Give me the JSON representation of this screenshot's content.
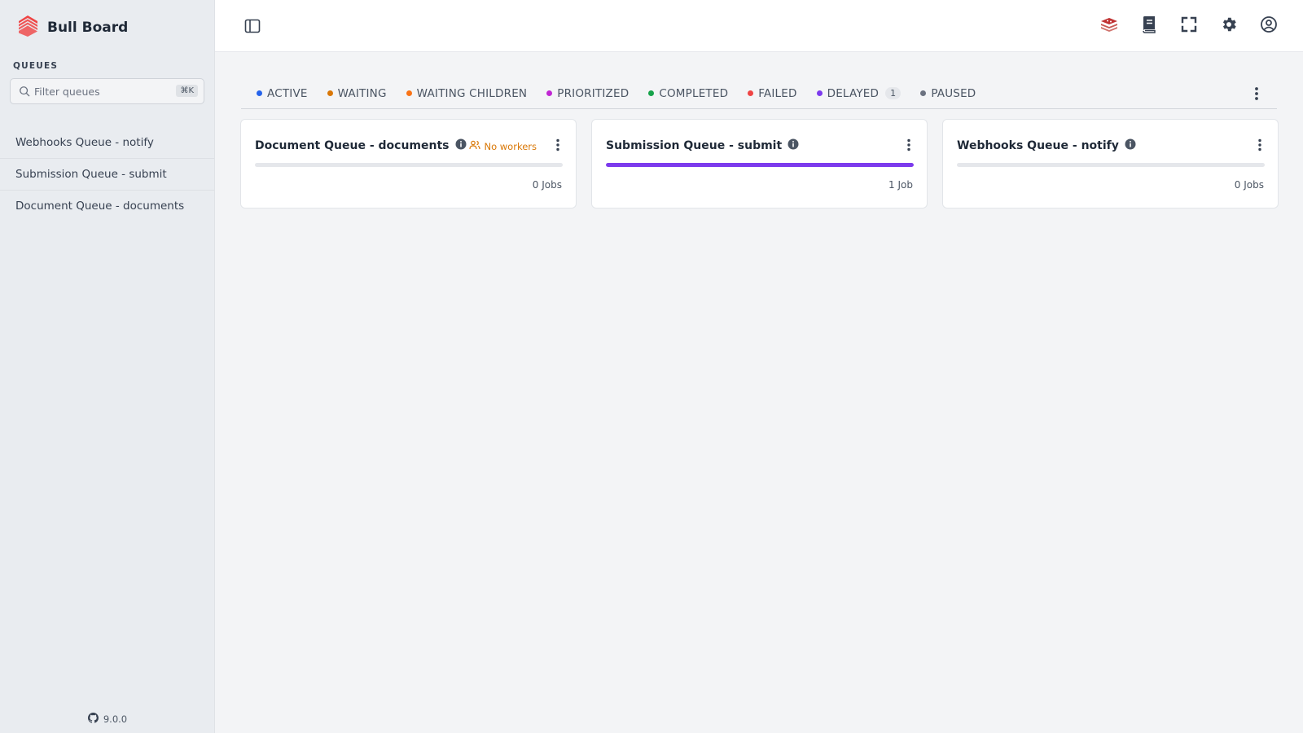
{
  "app": {
    "title": "Bull Board",
    "version": "9.0.0"
  },
  "sidebar": {
    "section_label": "QUEUES",
    "search": {
      "placeholder": "Filter queues",
      "shortcut": "⌘K"
    },
    "queues": [
      {
        "label": "Webhooks Queue - notify"
      },
      {
        "label": "Submission Queue - submit"
      },
      {
        "label": "Document Queue - documents"
      }
    ]
  },
  "header": {
    "icons": [
      "redis-icon",
      "docs-icon",
      "fullscreen-icon",
      "settings-icon",
      "user-icon"
    ]
  },
  "status_tabs": [
    {
      "label": "ACTIVE",
      "color": "#2563eb",
      "count": ""
    },
    {
      "label": "WAITING",
      "color": "#d97706",
      "count": ""
    },
    {
      "label": "WAITING CHILDREN",
      "color": "#f97316",
      "count": ""
    },
    {
      "label": "PRIORITIZED",
      "color": "#c026d3",
      "count": ""
    },
    {
      "label": "COMPLETED",
      "color": "#16a34a",
      "count": ""
    },
    {
      "label": "FAILED",
      "color": "#ef4444",
      "count": ""
    },
    {
      "label": "DELAYED",
      "color": "#7c3aed",
      "count": "1"
    },
    {
      "label": "PAUSED",
      "color": "#6b7280",
      "count": ""
    }
  ],
  "cards": [
    {
      "title": "Document Queue - documents",
      "workers_warning": "No workers",
      "jobs": "0 Jobs",
      "progress": 0
    },
    {
      "title": "Submission Queue - submit",
      "workers_warning": "",
      "jobs": "1 Job",
      "progress": 1
    },
    {
      "title": "Webhooks Queue - notify",
      "workers_warning": "",
      "jobs": "0 Jobs",
      "progress": 0
    }
  ],
  "colors": {
    "accent": "#7c3aed",
    "warning": "#d97706",
    "logo": "#ef4444"
  }
}
